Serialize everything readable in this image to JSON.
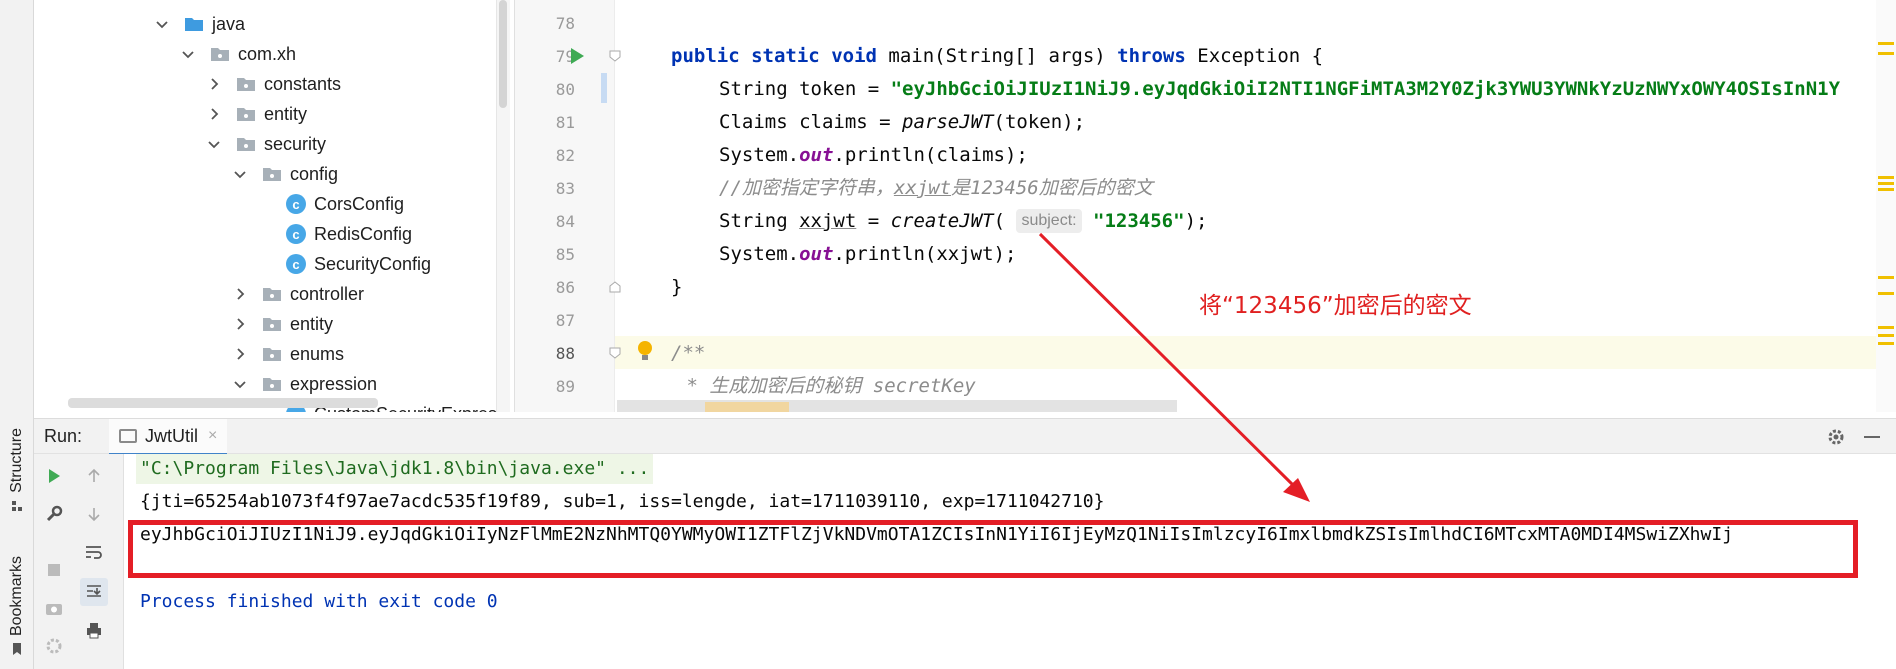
{
  "side_tabs": {
    "structure": "Structure",
    "bookmarks": "Bookmarks"
  },
  "tree": {
    "items": [
      {
        "label": "java",
        "kind": "folder-blue",
        "expanded": true
      },
      {
        "label": "com.xh",
        "kind": "package",
        "expanded": true
      },
      {
        "label": "constants",
        "kind": "package",
        "expanded": false
      },
      {
        "label": "entity",
        "kind": "package",
        "expanded": false
      },
      {
        "label": "security",
        "kind": "package",
        "expanded": true
      },
      {
        "label": "config",
        "kind": "package",
        "expanded": true
      },
      {
        "label": "CorsConfig",
        "kind": "class"
      },
      {
        "label": "RedisConfig",
        "kind": "class"
      },
      {
        "label": "SecurityConfig",
        "kind": "class"
      },
      {
        "label": "controller",
        "kind": "package",
        "expanded": false
      },
      {
        "label": "entity",
        "kind": "package",
        "expanded": false
      },
      {
        "label": "enums",
        "kind": "package",
        "expanded": false
      },
      {
        "label": "expression",
        "kind": "package",
        "expanded": true
      },
      {
        "label": "CustomSecurityExpress",
        "kind": "class"
      }
    ]
  },
  "editor": {
    "line_numbers": [
      "78",
      "79",
      "80",
      "81",
      "82",
      "83",
      "84",
      "85",
      "86",
      "87",
      "88",
      "89"
    ],
    "code": {
      "l79_public": "public",
      "l79_static": "static",
      "l79_void": "void",
      "l79_sig": " main(String[] args) ",
      "l79_throws": "throws",
      "l79_tail": " Exception {",
      "l80_pre": "String token = ",
      "l80_str": "\"eyJhbGciOiJIUzI1NiJ9.eyJqdGkiOiI2NTI1NGFiMTA3M2Y0Zjk3YWU3YWNkYzUzNWYxOWY4OSIsInN1Y",
      "l81_pre": "Claims claims = ",
      "l81_call": "parseJWT",
      "l81_tail": "(token);",
      "l82_pre": "System.",
      "l82_out": "out",
      "l82_tail": ".println(claims);",
      "l83_comment_a": "//加密指定字符串，",
      "l83_comment_var": "xxjwt",
      "l83_comment_b": "是123456加密后的密文",
      "l84_pre": "String ",
      "l84_var": "xxjwt",
      "l84_eq": " = ",
      "l84_call": "createJWT",
      "l84_paren": "( ",
      "l84_hint": "subject:",
      "l84_str": "\"123456\"",
      "l84_tail": ");",
      "l85_pre": "System.",
      "l85_out": "out",
      "l85_tail": ".println(xxjwt);",
      "l86": "}",
      "l88": "/**",
      "l89_a": " * 生成加密后的秘钥 ",
      "l89_b": "secretKey"
    }
  },
  "annotation": {
    "text": "将“123456”加密后的密文"
  },
  "run": {
    "label": "Run:",
    "tab": "JwtUtil",
    "close": "×",
    "console": {
      "cmd": "\"C:\\Program Files\\Java\\jdk1.8\\bin\\java.exe\" ...",
      "claims": "{jti=65254ab1073f4f97ae7acdc535f19f89, sub=1, iss=lengde, iat=1711039110, exp=1711042710}",
      "token": "eyJhbGciOiJIUzI1NiJ9.eyJqdGkiOiIyNzFlMmE2NzNhMTQ0YWMyOWI1ZTFlZjVkNDVmOTA1ZCIsInN1YiI6IjEyMzQ1NiIsImlzcyI6ImxlbmdkZSIsImlhdCI6MTcxMTA0MDI4MSwiZXhwIj",
      "exit": "Process finished with exit code 0"
    }
  },
  "colors": {
    "keyword": "#0033b3",
    "string": "#067d17",
    "annotation": "#e02020",
    "highlight_box": "#e41e26"
  }
}
